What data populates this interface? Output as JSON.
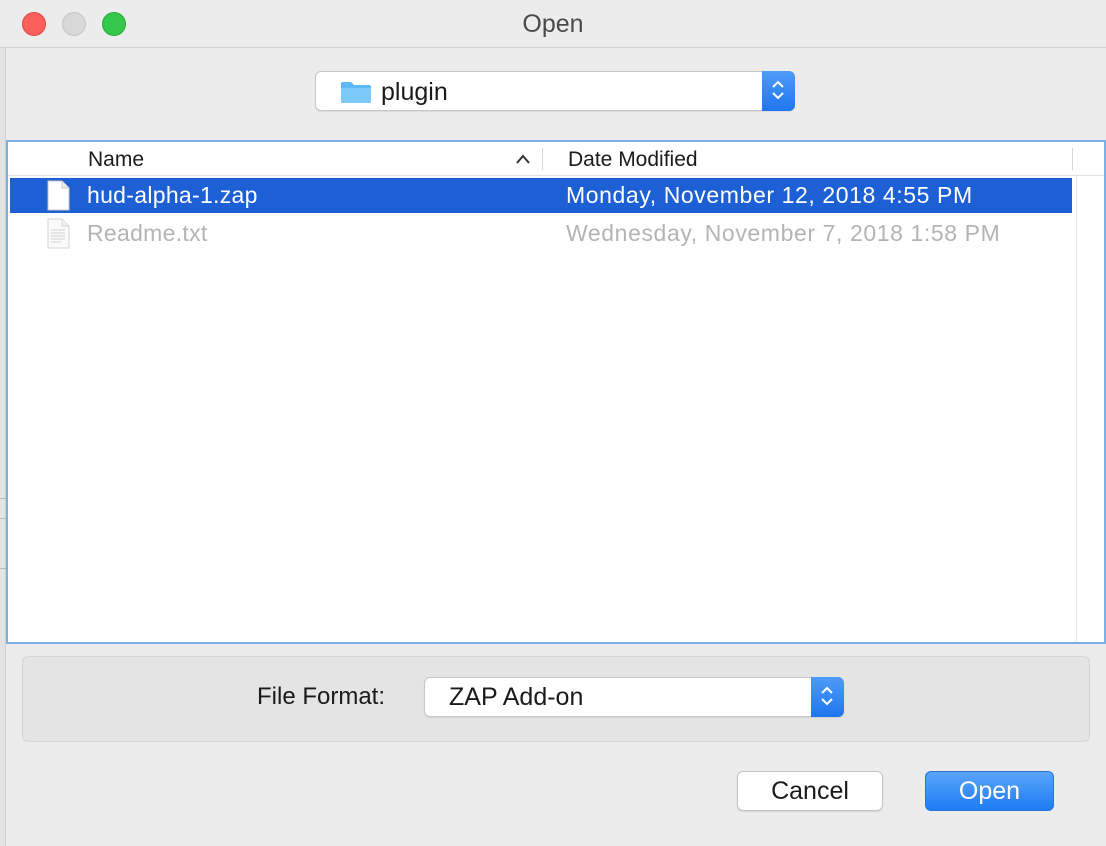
{
  "window": {
    "title": "Open"
  },
  "location": {
    "folder_name": "plugin",
    "icon": "folder-icon"
  },
  "file_list": {
    "columns": [
      "Name",
      "Date Modified"
    ],
    "sort_indicator": "chevron-up-icon",
    "files": [
      {
        "name": "hud-alpha-1.zap",
        "date_modified": "Monday, November 12, 2018 4:55 PM",
        "selected": true,
        "enabled": true
      },
      {
        "name": "Readme.txt",
        "date_modified": "Wednesday, November 7, 2018 1:58 PM",
        "selected": false,
        "enabled": false
      }
    ]
  },
  "format": {
    "label": "File Format:",
    "value": "ZAP Add-on"
  },
  "buttons": {
    "cancel": "Cancel",
    "open": "Open"
  },
  "colors": {
    "selection": "#1d60d6",
    "accent": "#1e7cf3",
    "close": "#fc605c",
    "maximize": "#34c84a",
    "disabled_text": "#b4b4b4"
  }
}
